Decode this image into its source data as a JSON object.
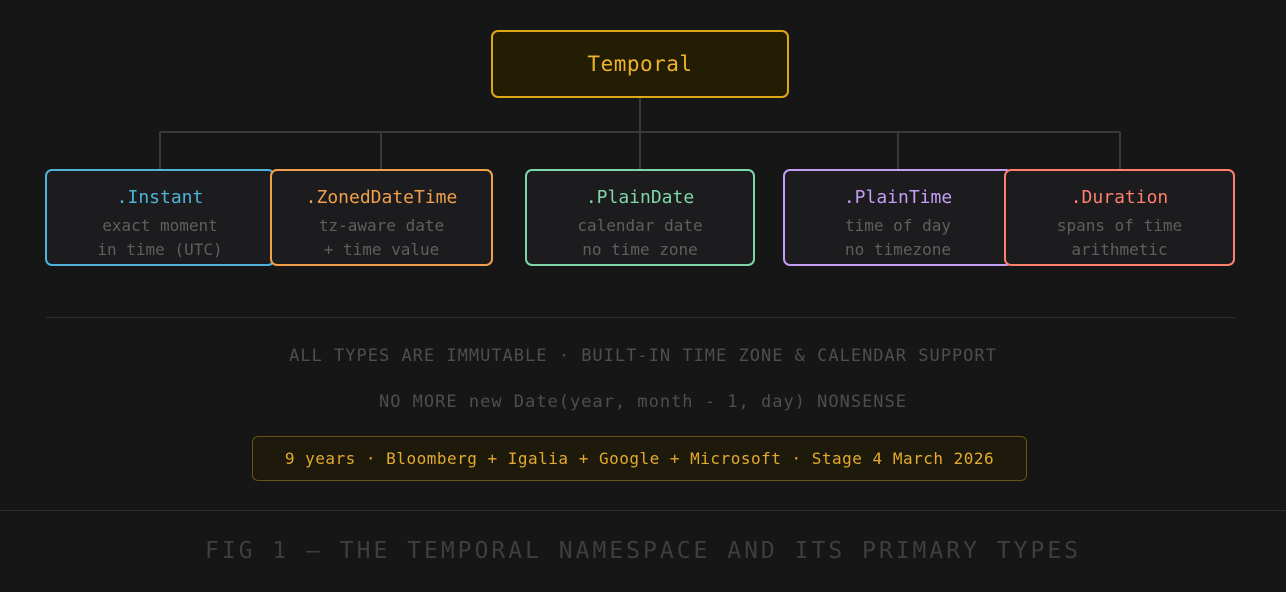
{
  "root": {
    "label": "Temporal",
    "color": "#e0a61a"
  },
  "types": [
    {
      "name": ".Instant",
      "line1": "exact moment",
      "line2": "in time (UTC)",
      "color": "#4fb3d9"
    },
    {
      "name": ".ZonedDateTime",
      "line1": "tz-aware date",
      "line2": "+ time value",
      "color": "#f0a04b"
    },
    {
      "name": ".PlainDate",
      "line1": "calendar date",
      "line2": "no time zone",
      "color": "#7fd6a8"
    },
    {
      "name": ".PlainTime",
      "line1": "time of day",
      "line2": "no timezone",
      "color": "#c49df5"
    },
    {
      "name": ".Duration",
      "line1": "spans of time",
      "line2": "arithmetic",
      "color": "#ff7f6e"
    }
  ],
  "notes": {
    "line1": "ALL TYPES ARE IMMUTABLE · BUILT-IN TIME ZONE & CALENDAR SUPPORT",
    "line2": "NO MORE new Date(year, month - 1, day) NONSENSE"
  },
  "credit": "9 years · Bloomberg + Igalia + Google + Microsoft · Stage 4 March 2026",
  "caption": "FIG 1 — THE TEMPORAL NAMESPACE AND ITS PRIMARY TYPES"
}
